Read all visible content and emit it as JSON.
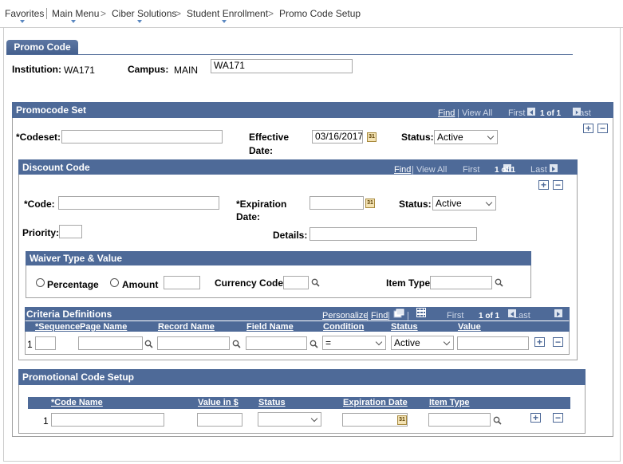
{
  "breadcrumb": {
    "items": [
      "Favorites",
      "Main Menu",
      "Ciber Solutions",
      "Student Enrollment",
      "Promo Code Setup"
    ],
    "separator": ">"
  },
  "page": {
    "tab_label": "Promo Code",
    "institution_label": "Institution:",
    "institution_value": "WA171",
    "campus_label": "Campus:",
    "campus_value": "MAIN",
    "campus_input_value": "WA171"
  },
  "grid_nav": {
    "find": "Find",
    "view_all": "View All",
    "first": "First",
    "count": "1 of 1",
    "last": "Last",
    "personalize": "Personalize",
    "separator": "|"
  },
  "promocode_set": {
    "title": "Promocode Set",
    "codeset_label": "*Codeset:",
    "effective_label_1": "Effective",
    "effective_label_2": "Date:",
    "effective_value": "03/16/2017",
    "status_label": "Status:",
    "status_value": "Active"
  },
  "discount_code": {
    "title": "Discount Code",
    "code_label": "*Code:",
    "expiration_label_1": "*Expiration",
    "expiration_label_2": "Date:",
    "status_label": "Status:",
    "status_value": "Active",
    "priority_label": "Priority:",
    "details_label": "Details:"
  },
  "waiver": {
    "title": "Waiver Type & Value",
    "percentage_label": "Percentage",
    "amount_label": "Amount",
    "currency_label": "Currency Code",
    "item_type_label": "Item Type"
  },
  "criteria": {
    "title": "Criteria Definitions",
    "columns": [
      "*Sequence",
      "Page Name",
      "Record Name",
      "Field Name",
      "Condition",
      "Status",
      "Value"
    ],
    "row_number": "1",
    "condition_value": "=",
    "status_value": "Active"
  },
  "promo_setup": {
    "title": "Promotional Code Setup",
    "columns": [
      "*Code Name",
      "Value in $",
      "Status",
      "Expiration Date",
      "Item Type"
    ],
    "row_number": "1"
  },
  "icons": {
    "add": "plus",
    "delete": "minus",
    "calendar": "calendar-icon",
    "lookup": "magnifier-icon",
    "colors": {
      "header": "#4e6a98",
      "link": "#1a3a8a"
    }
  }
}
